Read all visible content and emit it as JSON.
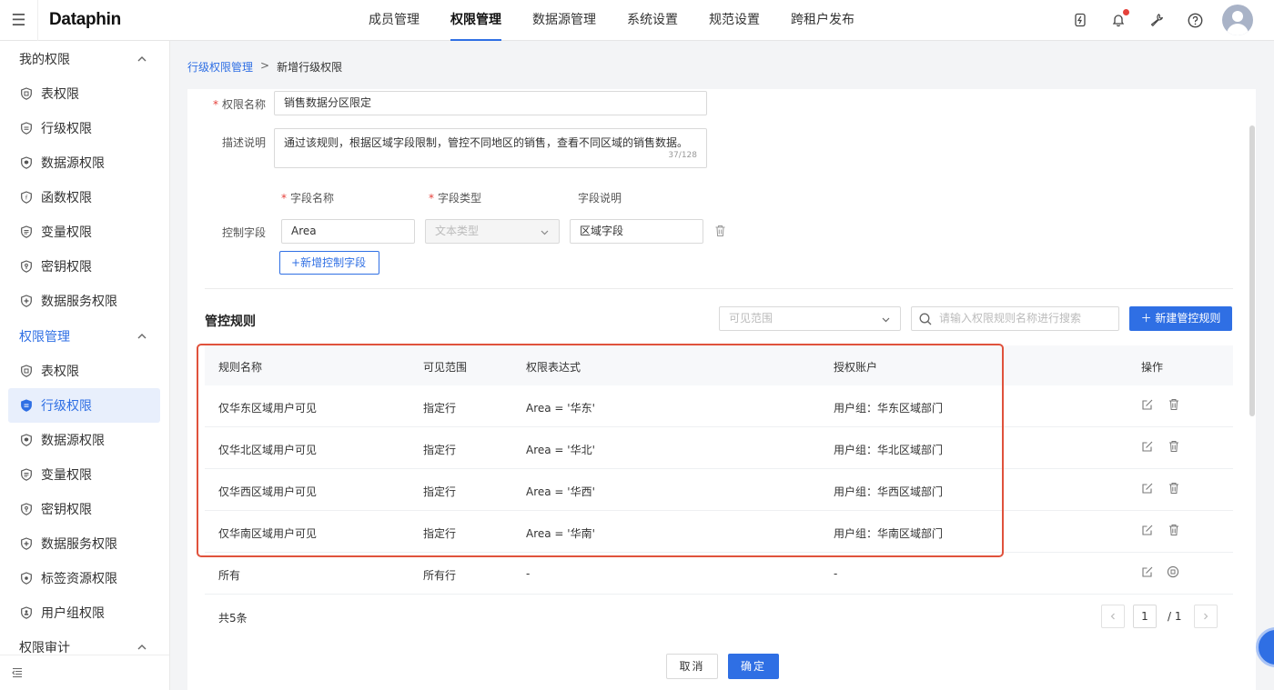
{
  "app": {
    "logo": "Dataphin"
  },
  "topnav": {
    "items": [
      {
        "label": "成员管理",
        "active": false
      },
      {
        "label": "权限管理",
        "active": true
      },
      {
        "label": "数据源管理",
        "active": false
      },
      {
        "label": "系统设置",
        "active": false
      },
      {
        "label": "规范设置",
        "active": false
      },
      {
        "label": "跨租户发布",
        "active": false
      }
    ],
    "tools": [
      "power-icon",
      "bell-icon",
      "wrench-icon",
      "help-icon",
      "avatar"
    ]
  },
  "sidebar": {
    "group1": {
      "label": "我的权限",
      "items": [
        "表权限",
        "行级权限",
        "数据源权限",
        "函数权限",
        "变量权限",
        "密钥权限",
        "数据服务权限"
      ]
    },
    "group2": {
      "label": "权限管理",
      "items": [
        "表权限",
        "行级权限",
        "数据源权限",
        "变量权限",
        "密钥权限",
        "数据服务权限",
        "标签资源权限",
        "用户组权限"
      ],
      "active_index": 1
    },
    "group3": {
      "label": "权限审计"
    }
  },
  "breadcrumb": {
    "parent": "行级权限管理",
    "separator": ">",
    "current": "新增行级权限"
  },
  "form": {
    "name_label": "权限名称",
    "name_value": "销售数据分区限定",
    "desc_label": "描述说明",
    "desc_value": "通过该规则，根据区域字段限制，管控不同地区的销售，查看不同区域的销售数据。",
    "desc_counter": "37/128",
    "field_col_name": "字段名称",
    "field_col_type": "字段类型",
    "field_col_desc": "字段说明",
    "control_field_label": "控制字段",
    "field_name_value": "Area",
    "field_type_placeholder": "文本类型",
    "field_desc_value": "区域字段",
    "add_field_button": "新增控制字段"
  },
  "rules": {
    "title": "管控规则",
    "scope_placeholder": "可见范围",
    "search_placeholder": "请输入权限规则名称进行搜索",
    "new_button": "新建管控规则",
    "columns": [
      "规则名称",
      "可见范围",
      "权限表达式",
      "授权账户",
      "操作"
    ],
    "rows": [
      {
        "name": "仅华东区域用户可见",
        "scope": "指定行",
        "expr": "Area = '华东'",
        "account": "用户组：华东区域部门"
      },
      {
        "name": "仅华北区域用户可见",
        "scope": "指定行",
        "expr": "Area = '华北'",
        "account": "用户组：华北区域部门"
      },
      {
        "name": "仅华西区域用户可见",
        "scope": "指定行",
        "expr": "Area = '华西'",
        "account": "用户组：华西区域部门"
      },
      {
        "name": "仅华南区域用户可见",
        "scope": "指定行",
        "expr": "Area = '华南'",
        "account": "用户组：华南区域部门"
      },
      {
        "name": "所有",
        "scope": "所有行",
        "expr": "-",
        "account": "-"
      }
    ],
    "total": "共5条",
    "pager": {
      "current": "1",
      "total": "/ 1"
    }
  },
  "footer": {
    "cancel": "取消",
    "ok": "确定"
  },
  "colors": {
    "primary": "#2f6fe4",
    "highlight": "#e0523c",
    "required": "#e5413b"
  }
}
